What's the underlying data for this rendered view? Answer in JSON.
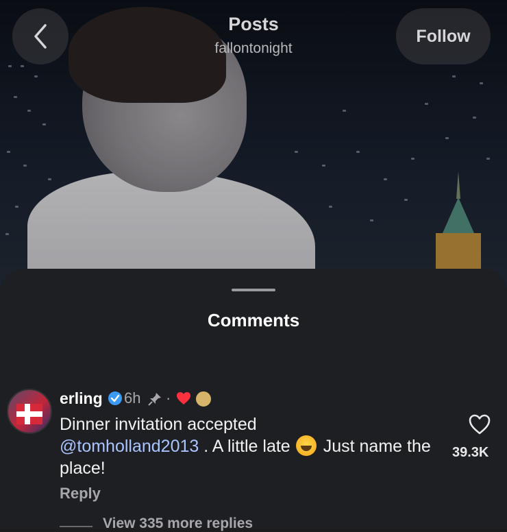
{
  "header": {
    "title": "Posts",
    "subtitle": "fallontonight",
    "follow_label": "Follow",
    "back_icon": "chevron-left-icon"
  },
  "sheet": {
    "title": "Comments"
  },
  "comment": {
    "username": "erling",
    "time": "6h",
    "dot": "·",
    "text_line1": "Dinner invitation accepted",
    "mention": "@tomholland2013",
    "text_mid": " . A little late",
    "text_after_emoji": "Just name the place!",
    "like_count": "39.3K",
    "reply_label": "Reply",
    "view_more": "View 335 more replies"
  },
  "colors": {
    "mention": "#a9c4ff",
    "verified": "#3b9af5",
    "liked_heart": "#ff3040",
    "sheet_bg": "#1e1f22"
  }
}
